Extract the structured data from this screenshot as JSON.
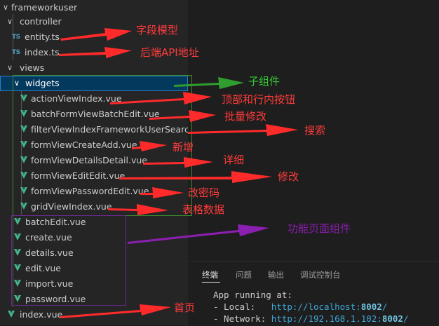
{
  "explorer": {
    "root": "frameworkuser",
    "controller_folder": "controller",
    "controller_files": [
      "entity.ts",
      "index.ts"
    ],
    "views_folder": "views",
    "widgets_folder": "widgets",
    "widget_files": [
      "actionViewIndex.vue",
      "batchFormViewBatchEdit.vue",
      "filterViewIndexFrameworkUserSearch...",
      "formViewCreateAdd.vue",
      "formViewDetailsDetail.vue",
      "formViewEditEdit.vue",
      "formViewPasswordEdit.vue",
      "gridViewIndex.vue"
    ],
    "view_files": [
      "batchEdit.vue",
      "create.vue",
      "details.vue",
      "edit.vue",
      "import.vue",
      "password.vue"
    ],
    "index_file": "index.vue",
    "ts_badge": "TS"
  },
  "annotations": {
    "entity": "字段模型",
    "index_ts": "后端API地址",
    "widgets": "子组件",
    "actionViewIndex": "顶部和行内按钮",
    "batchFormView": "批量修改",
    "filterView": "搜索",
    "formViewCreate": "新增",
    "formViewDetails": "详细",
    "formViewEdit": "修改",
    "formViewPassword": "改密码",
    "gridView": "表格数据",
    "pages": "功能页面组件",
    "index_vue": "首页"
  },
  "colors": {
    "annotation_red": "#ff3b3b",
    "annotation_green": "#33cc33",
    "annotation_purple": "#8b1fb0",
    "widgets_box": "#3a8a2a",
    "pages_box": "#6a2a8c"
  },
  "terminal": {
    "tabs": [
      "终端",
      "问题",
      "输出",
      "调试控制台"
    ],
    "line1": "App running at:",
    "local_label": "- Local:   ",
    "local_url": "http://localhost:",
    "local_port": "8002",
    "local_tail": "/",
    "network_label": "- Network: ",
    "network_url": "http://192.168.1.102:",
    "network_port": "8002",
    "network_tail": "/"
  }
}
